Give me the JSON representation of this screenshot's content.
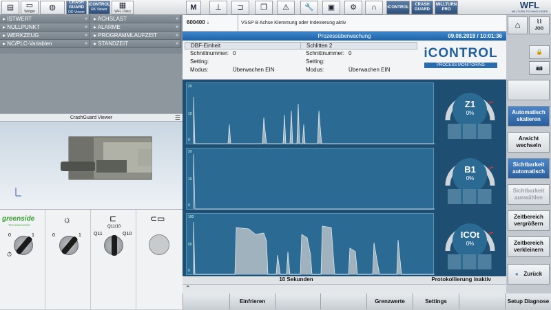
{
  "toolbar": {
    "left_labels": [
      "Widget",
      "",
      "OD Viewer",
      "RK Viewer",
      "WFL Doku"
    ],
    "crashguard": "CRASH GUARD",
    "icontrol": "iCONTROL",
    "millturn": "MILLTURN PRO",
    "wfl": "WFL",
    "wfl_sub": "MILLTURN TECHNOLOGIES"
  },
  "menu": {
    "left": [
      "ISTWERT",
      "NULLPUNKT",
      "WERKZEUG",
      "NC/PLC-Variablen"
    ],
    "right": [
      "ACHSLAST",
      "ALARME",
      "PROGRAMMLAUFZEIT",
      "STANDZEIT"
    ]
  },
  "crashguard_title": "CrashGuard Viewer",
  "tools": {
    "greenside": "greenside",
    "greenside_sub": "TECHNOLOGIES",
    "switch1": {
      "left": "0",
      "right": "1"
    },
    "switch2": {
      "left": "0",
      "right": "1"
    },
    "switch3": {
      "top": "Q11/10",
      "left": "Q11",
      "right": "Q10"
    }
  },
  "header": {
    "number": "600400 ↓",
    "message": "VSSP B Achse Klemmung oder Indexierung aktiv"
  },
  "process": {
    "title": "Prozessüberwachung",
    "datetime": "09.08.2019 / 10:01:36"
  },
  "panel1": {
    "title": "DBF-Einheit",
    "rows": [
      {
        "label": "Schnittnummer:",
        "value": "0"
      },
      {
        "label": "Setting:",
        "value": ""
      },
      {
        "label": "Modus:",
        "value": "Überwachen EIN"
      }
    ]
  },
  "panel2": {
    "title": "Schlitten 2",
    "rows": [
      {
        "label": "Schnittnummer:",
        "value": "0"
      },
      {
        "label": "Setting:",
        "value": ""
      },
      {
        "label": "Modus:",
        "value": "Überwachen EIN"
      }
    ]
  },
  "brand": {
    "name": "iCONTROL",
    "sub": "PROCESS MONITORING"
  },
  "charts": [
    {
      "ymax": "20",
      "ymid": "10",
      "ymin": "0",
      "gauge": "Z1",
      "pct": "0%"
    },
    {
      "ymax": "20",
      "ymid": "10",
      "ymin": "0",
      "gauge": "B1",
      "pct": "0%"
    },
    {
      "ymax": "100",
      "ymid": "50",
      "ymin": "0",
      "gauge": "ICOt",
      "pct": "0%"
    }
  ],
  "status": {
    "left": "10 Sekunden",
    "right": "Protokollierung inaktiv"
  },
  "bottom_keys": [
    "",
    "Einfrieren",
    "",
    "",
    "Grenzwerte",
    "Settings",
    "",
    "Setup Diagnose"
  ],
  "right_keys": {
    "jog": "JOG",
    "auto_scale": "Automatisch skalieren",
    "view": "Ansicht wechseln",
    "visibility": "Sichtbarkeit automatisch",
    "visibility_select": "Sichtbarkeit auswählen",
    "zoom_in": "Zeitbereich vergrößern",
    "zoom_out": "Zeitbereich verkleinern",
    "back": "Zurück"
  }
}
